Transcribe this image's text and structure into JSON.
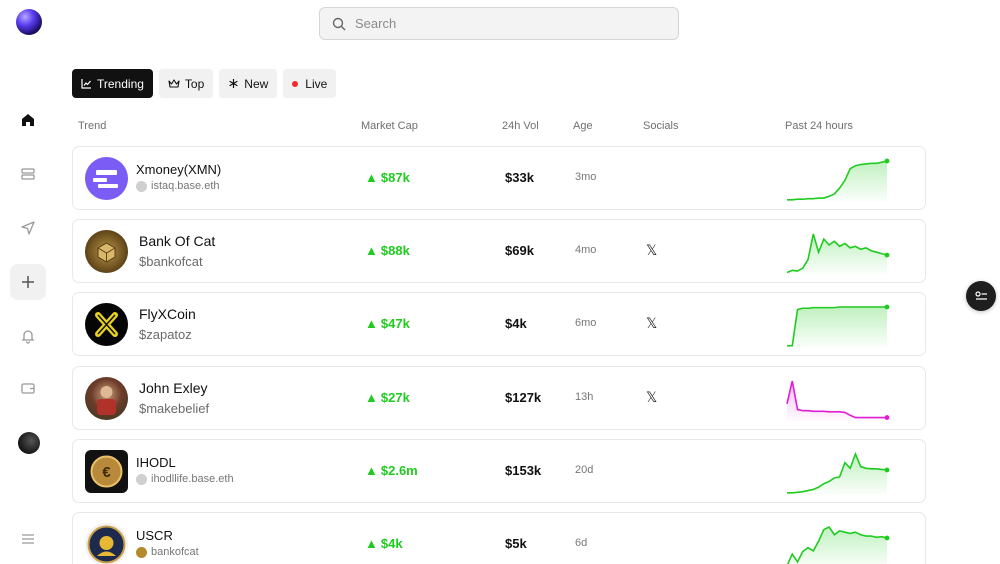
{
  "search": {
    "placeholder": "Search"
  },
  "tabs": [
    {
      "label": "Trending",
      "icon": "trend-icon",
      "active": true
    },
    {
      "label": "Top",
      "icon": "crown-icon"
    },
    {
      "label": "New",
      "icon": "asterisk-icon"
    },
    {
      "label": "Live",
      "icon": "live-dot-icon"
    }
  ],
  "columns": {
    "trend": "Trend",
    "market_cap": "Market Cap",
    "vol": "24h Vol",
    "age": "Age",
    "socials": "Socials",
    "past": "Past 24 hours"
  },
  "colors": {
    "up": "#1ecb1e",
    "down": "#e21bd6",
    "accent": "#111111"
  },
  "rows": [
    {
      "name": "Xmoney(XMN)",
      "handle": "istaq.base.eth",
      "market_cap": "$87k",
      "vol": "$33k",
      "age": "3mo",
      "social": "",
      "spark": [
        2,
        2,
        3,
        3,
        4,
        4,
        5,
        5,
        8,
        12,
        22,
        35,
        55,
        60,
        62,
        63,
        64,
        64,
        66,
        68
      ],
      "trend": "up"
    },
    {
      "name": "Bank Of Cat",
      "handle": "$bankofcat",
      "market_cap": "$88k",
      "vol": "$69k",
      "age": "4mo",
      "social": "𝕏",
      "spark": [
        2,
        5,
        4,
        8,
        20,
        55,
        30,
        48,
        40,
        45,
        38,
        42,
        36,
        38,
        34,
        36,
        32,
        30,
        28,
        26
      ],
      "trend": "up"
    },
    {
      "name": "FlyXCoin",
      "handle": "$zapatoz",
      "market_cap": "$47k",
      "vol": "$4k",
      "age": "6mo",
      "social": "𝕏",
      "spark": [
        2,
        2,
        60,
        62,
        62,
        63,
        63,
        63,
        63,
        63,
        64,
        64,
        64,
        64,
        64,
        64,
        64,
        64,
        64,
        64
      ],
      "trend": "up"
    },
    {
      "name": "John Exley",
      "handle": "$makebelief",
      "market_cap": "$27k",
      "vol": "$127k",
      "age": "13h",
      "social": "𝕏",
      "spark": [
        30,
        70,
        20,
        18,
        18,
        17,
        17,
        17,
        16,
        16,
        16,
        15,
        10,
        6,
        6,
        6,
        6,
        6,
        6,
        6
      ],
      "trend": "down"
    },
    {
      "name": "IHODL",
      "handle": "ihodllife.base.eth",
      "market_cap": "$2.6m",
      "vol": "$153k",
      "age": "20d",
      "social": "",
      "spark": [
        2,
        2,
        3,
        4,
        6,
        8,
        12,
        18,
        22,
        28,
        30,
        55,
        45,
        70,
        48,
        45,
        44,
        44,
        43,
        42
      ],
      "trend": "up"
    },
    {
      "name": "USCR",
      "handle": "bankofcat",
      "market_cap": "$4k",
      "vol": "$5k",
      "age": "6d",
      "social": "",
      "spark": [
        2,
        20,
        8,
        24,
        30,
        25,
        40,
        58,
        62,
        50,
        56,
        54,
        52,
        54,
        50,
        48,
        48,
        46,
        47,
        45
      ],
      "trend": "up"
    }
  ]
}
